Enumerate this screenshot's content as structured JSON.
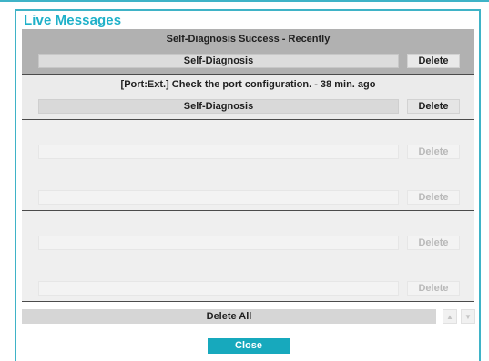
{
  "dialog": {
    "title": "Live Messages",
    "accent_color": "#17a9bd"
  },
  "messages": [
    {
      "text": "Self-Diagnosis Success - Recently",
      "type": "Self-Diagnosis",
      "delete_label": "Delete",
      "state": "selected"
    },
    {
      "text": "[Port:Ext.] Check the port configuration. - 38 min. ago",
      "type": "Self-Diagnosis",
      "delete_label": "Delete",
      "state": "normal"
    },
    {
      "text": "",
      "type": "",
      "delete_label": "Delete",
      "state": "empty"
    },
    {
      "text": "",
      "type": "",
      "delete_label": "Delete",
      "state": "empty"
    },
    {
      "text": "",
      "type": "",
      "delete_label": "Delete",
      "state": "empty"
    },
    {
      "text": "",
      "type": "",
      "delete_label": "Delete",
      "state": "empty"
    }
  ],
  "footer": {
    "delete_all_label": "Delete All",
    "scroll_up_icon": "triangle-up",
    "scroll_down_icon": "triangle-down",
    "close_label": "Close"
  }
}
